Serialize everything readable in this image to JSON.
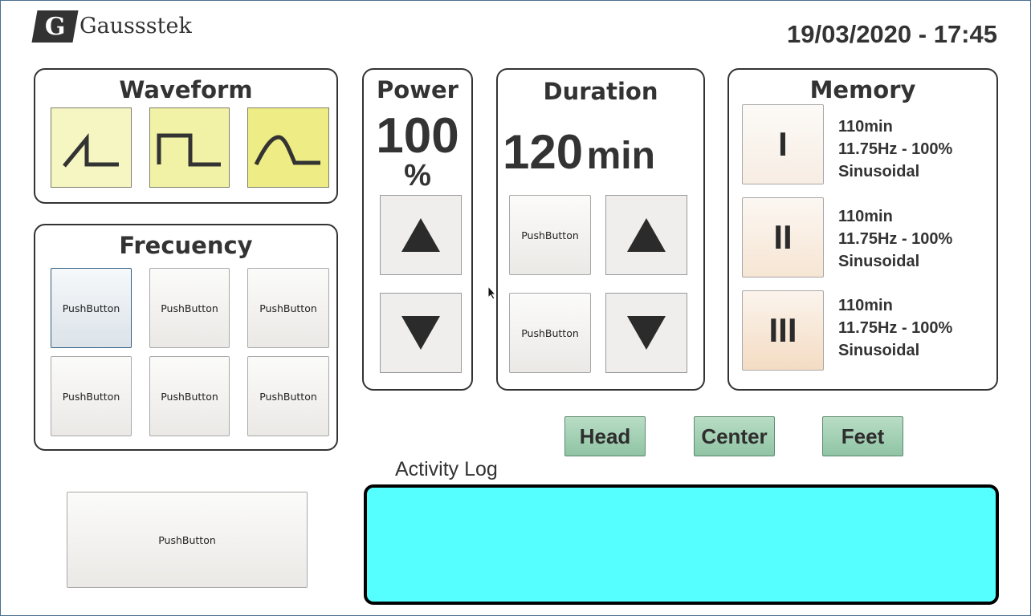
{
  "header": {
    "logo_text": "Gaussstek",
    "logo_mark": "G",
    "datetime": "19/03/2020 - 17:45"
  },
  "waveform": {
    "title": "Waveform",
    "options": [
      {
        "icon": "sawtooth-wave-icon",
        "color": "#f6f6c2"
      },
      {
        "icon": "square-wave-icon",
        "color": "#f2f2a6"
      },
      {
        "icon": "sine-wave-icon",
        "color": "#eeec84"
      }
    ]
  },
  "frequency": {
    "title": "Frecuency",
    "buttons": [
      "PushButton",
      "PushButton",
      "PushButton",
      "PushButton",
      "PushButton",
      "PushButton"
    ]
  },
  "power": {
    "title": "Power",
    "value": "100",
    "unit": "%"
  },
  "duration": {
    "title": "Duration",
    "value": "120",
    "unit": "min",
    "buttons": [
      "PushButton",
      "PushButton"
    ]
  },
  "memory": {
    "title": "Memory",
    "slots": [
      {
        "label": "I",
        "duration": "110min",
        "freq_power": "11.75Hz - 100%",
        "waveform": "Sinusoidal"
      },
      {
        "label": "II",
        "duration": "110min",
        "freq_power": "11.75Hz - 100%",
        "waveform": "Sinusoidal"
      },
      {
        "label": "III",
        "duration": "110min",
        "freq_power": "11.75Hz - 100%",
        "waveform": "Sinusoidal"
      }
    ]
  },
  "positions": {
    "head": "Head",
    "center": "Center",
    "feet": "Feet"
  },
  "activity_log": {
    "label": "Activity Log",
    "content": "",
    "background": "#55ffff"
  },
  "bottom_button": "PushButton",
  "colors": {
    "position_button": "#9fcfb1",
    "panel_border": "#333333",
    "log_background": "#55ffff"
  }
}
